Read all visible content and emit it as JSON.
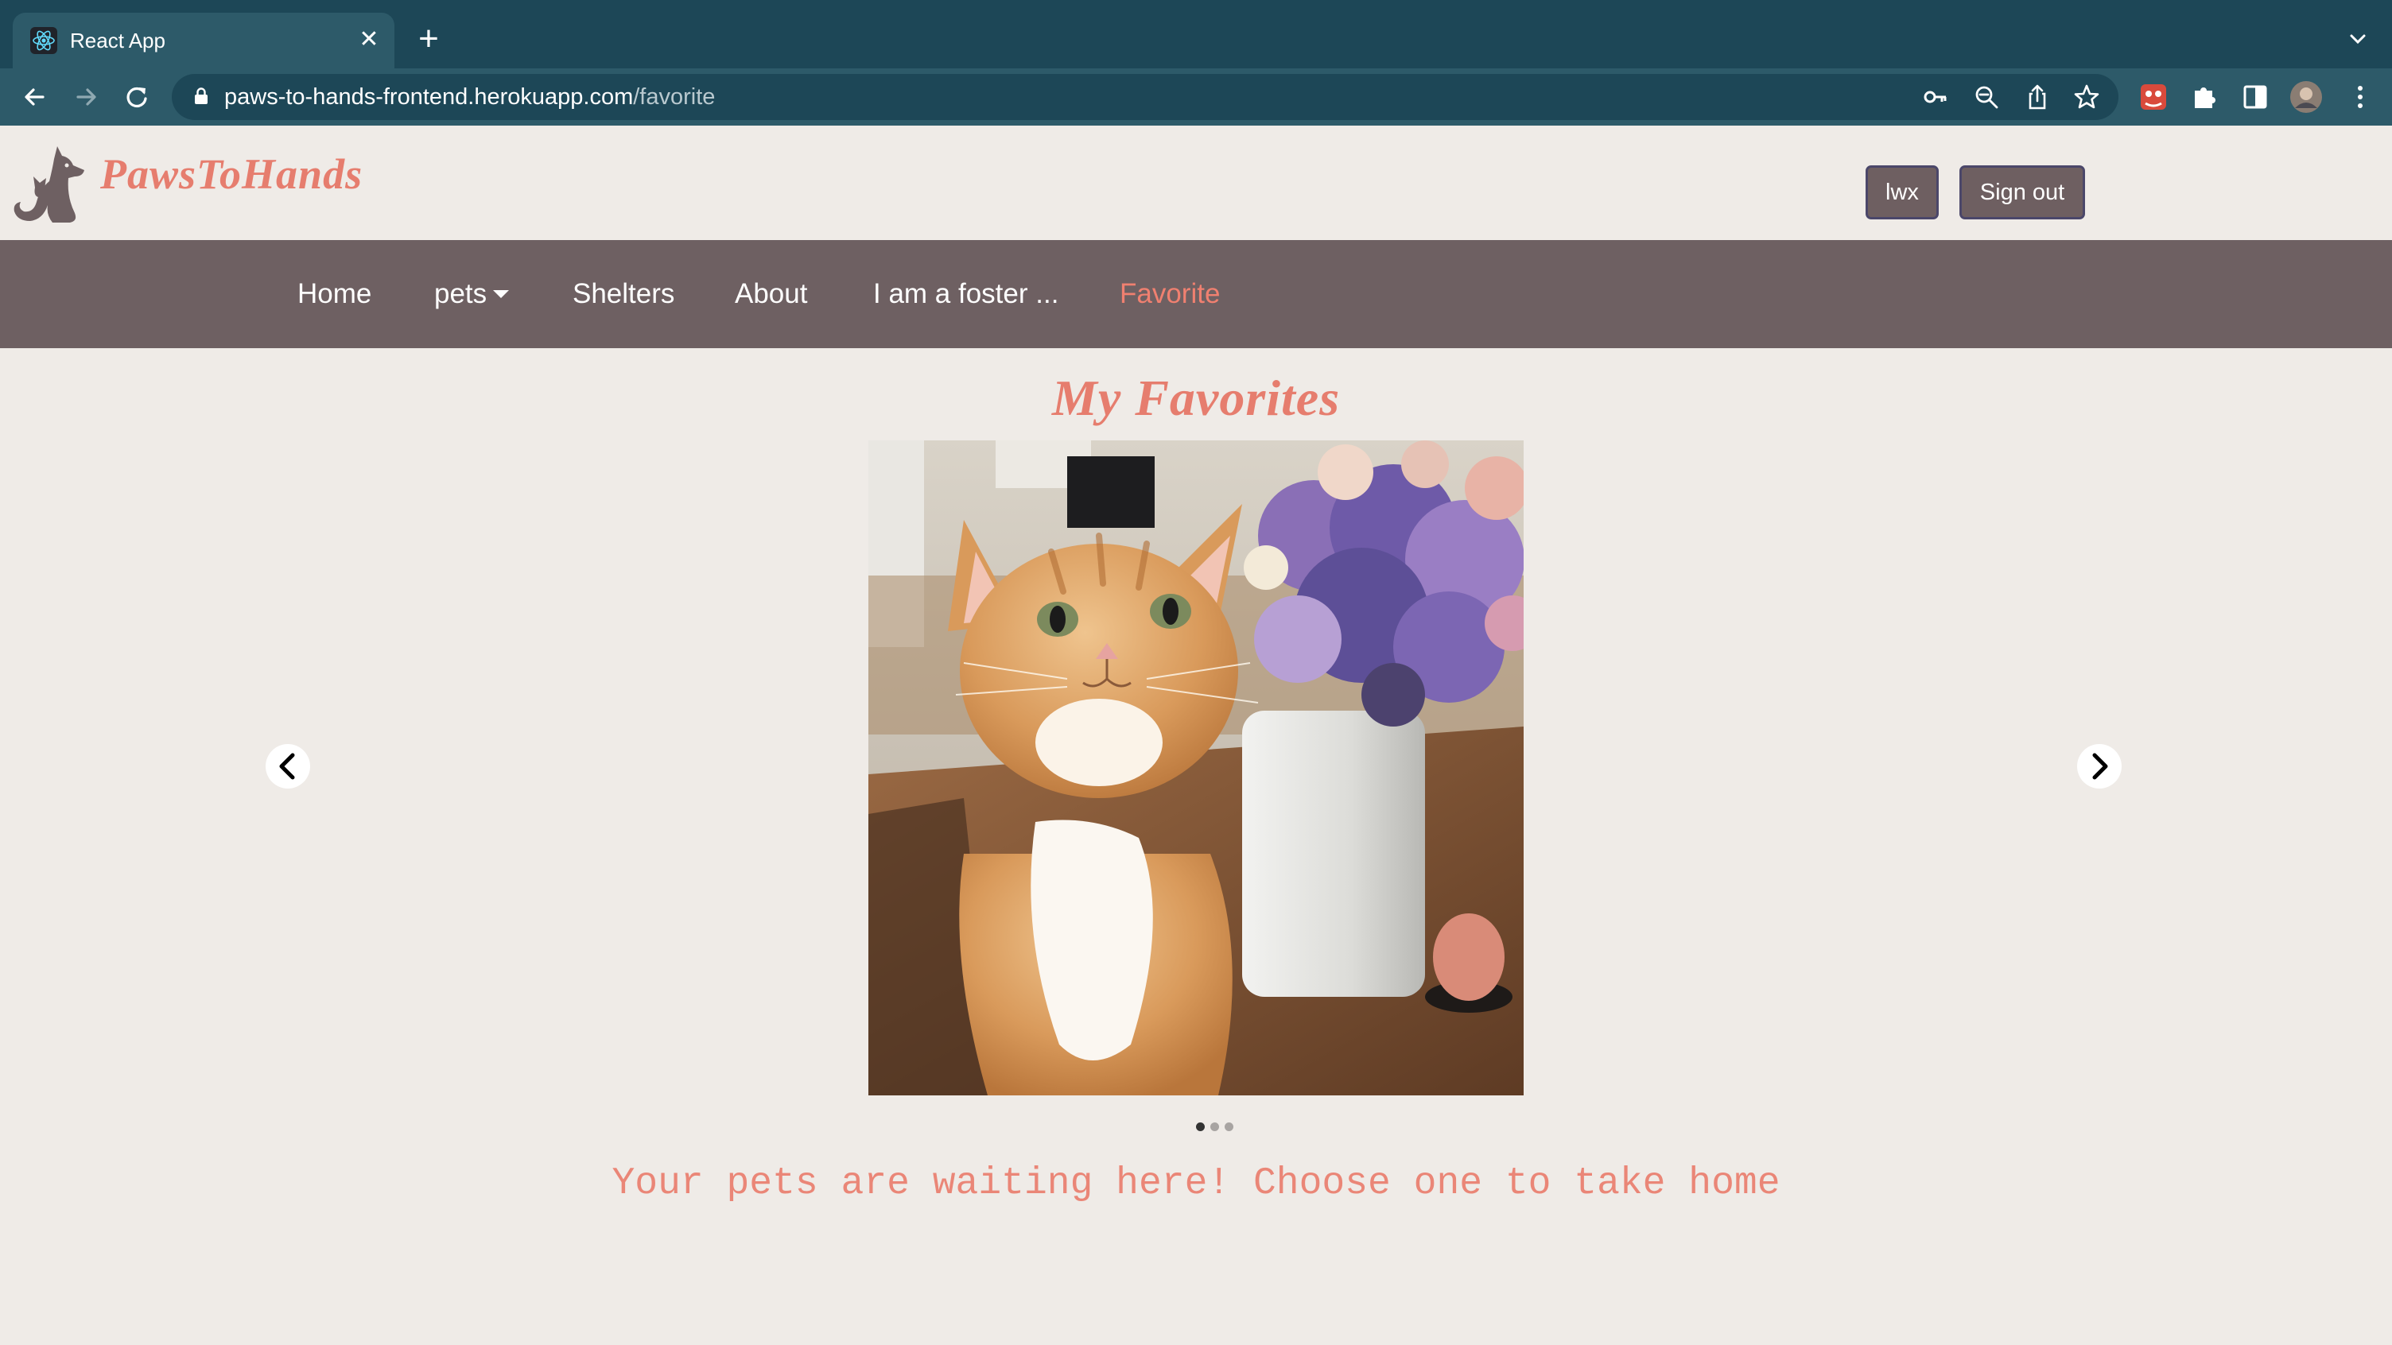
{
  "browser": {
    "tab_title": "React App",
    "url_host": "paws-to-hands-frontend.herokuapp.com",
    "url_path": "/favorite"
  },
  "header": {
    "brand": "PawsToHands",
    "user_label": "lwx",
    "signout_label": "Sign out"
  },
  "nav": {
    "items": [
      {
        "label": "Home"
      },
      {
        "label": "pets"
      },
      {
        "label": "Shelters"
      },
      {
        "label": "About"
      },
      {
        "label": "I am a foster ..."
      },
      {
        "label": "Favorite"
      }
    ],
    "active": "Favorite"
  },
  "main": {
    "title": "My Favorites",
    "carousel": {
      "slide_count": 3,
      "active_index": 0,
      "image": "orange-tabby-cat-with-dried-flowers-photo"
    },
    "tagline": "Your pets are waiting here! Choose one to take home"
  },
  "colors": {
    "accent": "#e67d6e",
    "nav_bg": "#6e6062",
    "page_bg": "#efebe7",
    "chrome_bg": "#1d4757"
  }
}
